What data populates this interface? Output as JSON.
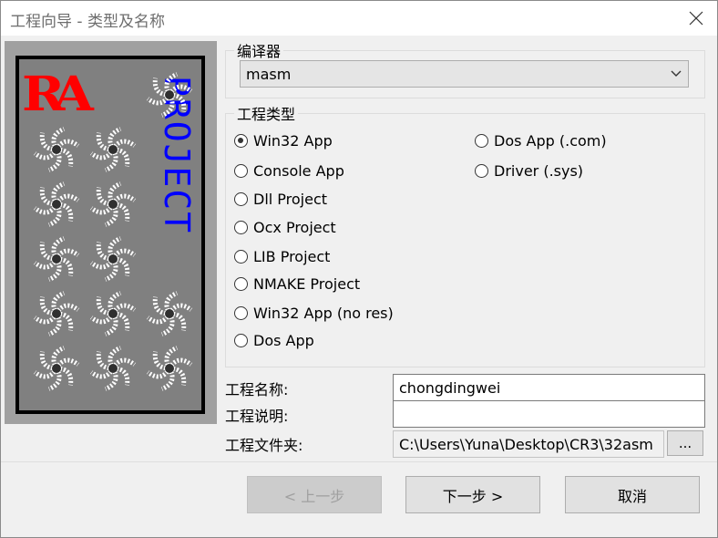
{
  "window": {
    "title": "工程向导 - 类型及名称"
  },
  "image": {
    "logo_text": "RA",
    "side_text": "PROJECT"
  },
  "compiler": {
    "group_label": "编译器",
    "selected": "masm"
  },
  "project_type": {
    "group_label": "工程类型",
    "options": [
      {
        "label": "Win32 App",
        "checked": true
      },
      {
        "label": "Console App",
        "checked": false
      },
      {
        "label": "Dll Project",
        "checked": false
      },
      {
        "label": "Ocx Project",
        "checked": false
      },
      {
        "label": "LIB Project",
        "checked": false
      },
      {
        "label": "NMAKE Project",
        "checked": false
      },
      {
        "label": "Win32 App (no res)",
        "checked": false
      },
      {
        "label": "Dos App",
        "checked": false
      },
      {
        "label": "Dos App (.com)",
        "checked": false
      },
      {
        "label": "Driver (.sys)",
        "checked": false
      }
    ]
  },
  "fields": {
    "name_label": "工程名称:",
    "name_value": "chongdingwei",
    "desc_label": "工程说明:",
    "desc_value": "",
    "folder_label": "工程文件夹:",
    "folder_value": "C:\\Users\\Yuna\\Desktop\\CR3\\32asm",
    "browse_label": "..."
  },
  "buttons": {
    "prev": "< 上一步",
    "next": "下一步 >",
    "cancel": "取消"
  }
}
